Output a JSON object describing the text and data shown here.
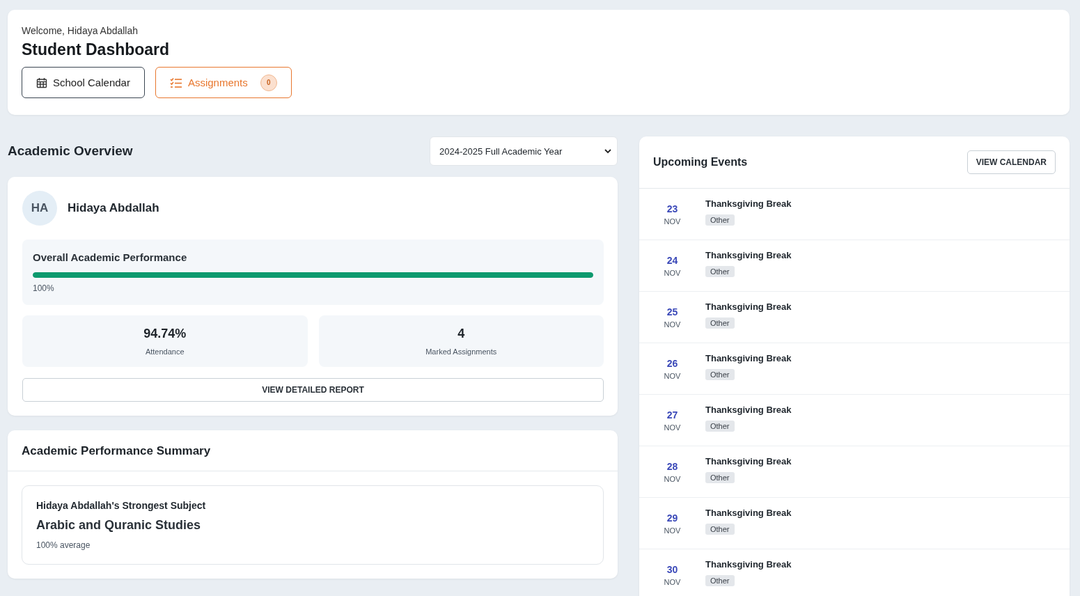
{
  "header": {
    "welcome": "Welcome, Hidaya Abdallah",
    "title": "Student Dashboard",
    "buttons": [
      {
        "kind": "calendar",
        "label": "School Calendar"
      },
      {
        "kind": "assignments",
        "label": "Assignments",
        "badge": "0"
      }
    ]
  },
  "overview": {
    "title": "Academic Overview",
    "period_select": {
      "value": "2024-2025 Full Academic Year"
    },
    "student": {
      "initials": "HA",
      "name": "Hidaya Abdallah"
    },
    "performance": {
      "label": "Overall Academic Performance",
      "level": 1,
      "reading": "100%"
    },
    "stats": [
      {
        "value": "94.74%",
        "label": "Attendance"
      },
      {
        "value": "4",
        "label": "Marked Assignments"
      }
    ],
    "report_button": "VIEW DETAILED REPORT"
  },
  "summary": {
    "title": "Academic Performance Summary",
    "heading": "Hidaya Abdallah's Strongest Subject",
    "subject": "Arabic and Quranic Studies",
    "average": "100% average"
  },
  "events": {
    "title": "Upcoming Events",
    "button": "VIEW CALENDAR",
    "items": [
      {
        "day": "23",
        "month": "NOV",
        "name": "Thanksgiving Break",
        "tag": "Other"
      },
      {
        "day": "24",
        "month": "NOV",
        "name": "Thanksgiving Break",
        "tag": "Other"
      },
      {
        "day": "25",
        "month": "NOV",
        "name": "Thanksgiving Break",
        "tag": "Other"
      },
      {
        "day": "26",
        "month": "NOV",
        "name": "Thanksgiving Break",
        "tag": "Other"
      },
      {
        "day": "27",
        "month": "NOV",
        "name": "Thanksgiving Break",
        "tag": "Other"
      },
      {
        "day": "28",
        "month": "NOV",
        "name": "Thanksgiving Break",
        "tag": "Other"
      },
      {
        "day": "29",
        "month": "NOV",
        "name": "Thanksgiving Break",
        "tag": "Other"
      },
      {
        "day": "30",
        "month": "NOV",
        "name": "Thanksgiving Break",
        "tag": "Other"
      }
    ]
  }
}
